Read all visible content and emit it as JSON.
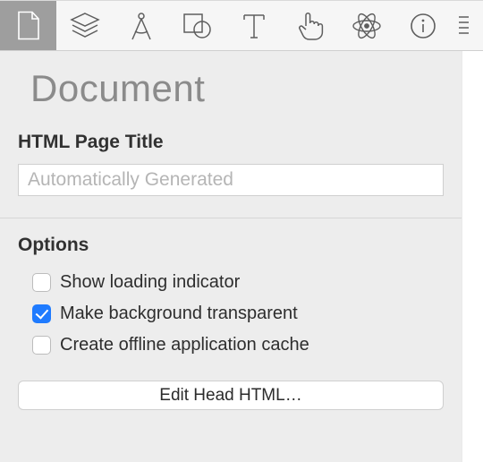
{
  "toolbar": {
    "tabs": [
      {
        "name": "document",
        "active": true
      },
      {
        "name": "layers",
        "active": false
      },
      {
        "name": "geometry",
        "active": false
      },
      {
        "name": "shape",
        "active": false
      },
      {
        "name": "text",
        "active": false
      },
      {
        "name": "interaction",
        "active": false
      },
      {
        "name": "physics",
        "active": false
      },
      {
        "name": "info",
        "active": false
      }
    ]
  },
  "panel": {
    "title": "Document",
    "html_title_label": "HTML Page Title",
    "html_title_placeholder": "Automatically Generated",
    "html_title_value": "",
    "options_label": "Options",
    "options": [
      {
        "label": "Show loading indicator",
        "checked": false
      },
      {
        "label": "Make background transparent",
        "checked": true
      },
      {
        "label": "Create offline application cache",
        "checked": false
      }
    ],
    "edit_head_label": "Edit Head HTML…"
  }
}
